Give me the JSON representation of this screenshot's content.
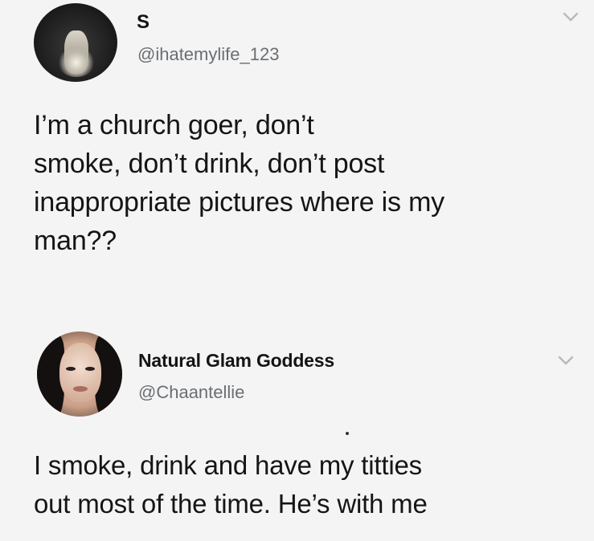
{
  "tweets": [
    {
      "display_name": "S",
      "handle": "@ihatemylife_123",
      "text": "I’m a church goer, don’t\nsmoke, don’t drink, don’t post\ninappropriate pictures where is my\nman??"
    },
    {
      "display_name": "Natural Glam Goddess",
      "handle": "@Chaantellie",
      "text": "I smoke, drink and have my titties\nout most of the time. He’s with me"
    }
  ],
  "icons": {
    "menu": "chevron-down-icon"
  },
  "colors": {
    "background": "#f4f4f4",
    "text": "#161616",
    "handle": "#6a6f74",
    "chevron": "#b9b9b9"
  }
}
